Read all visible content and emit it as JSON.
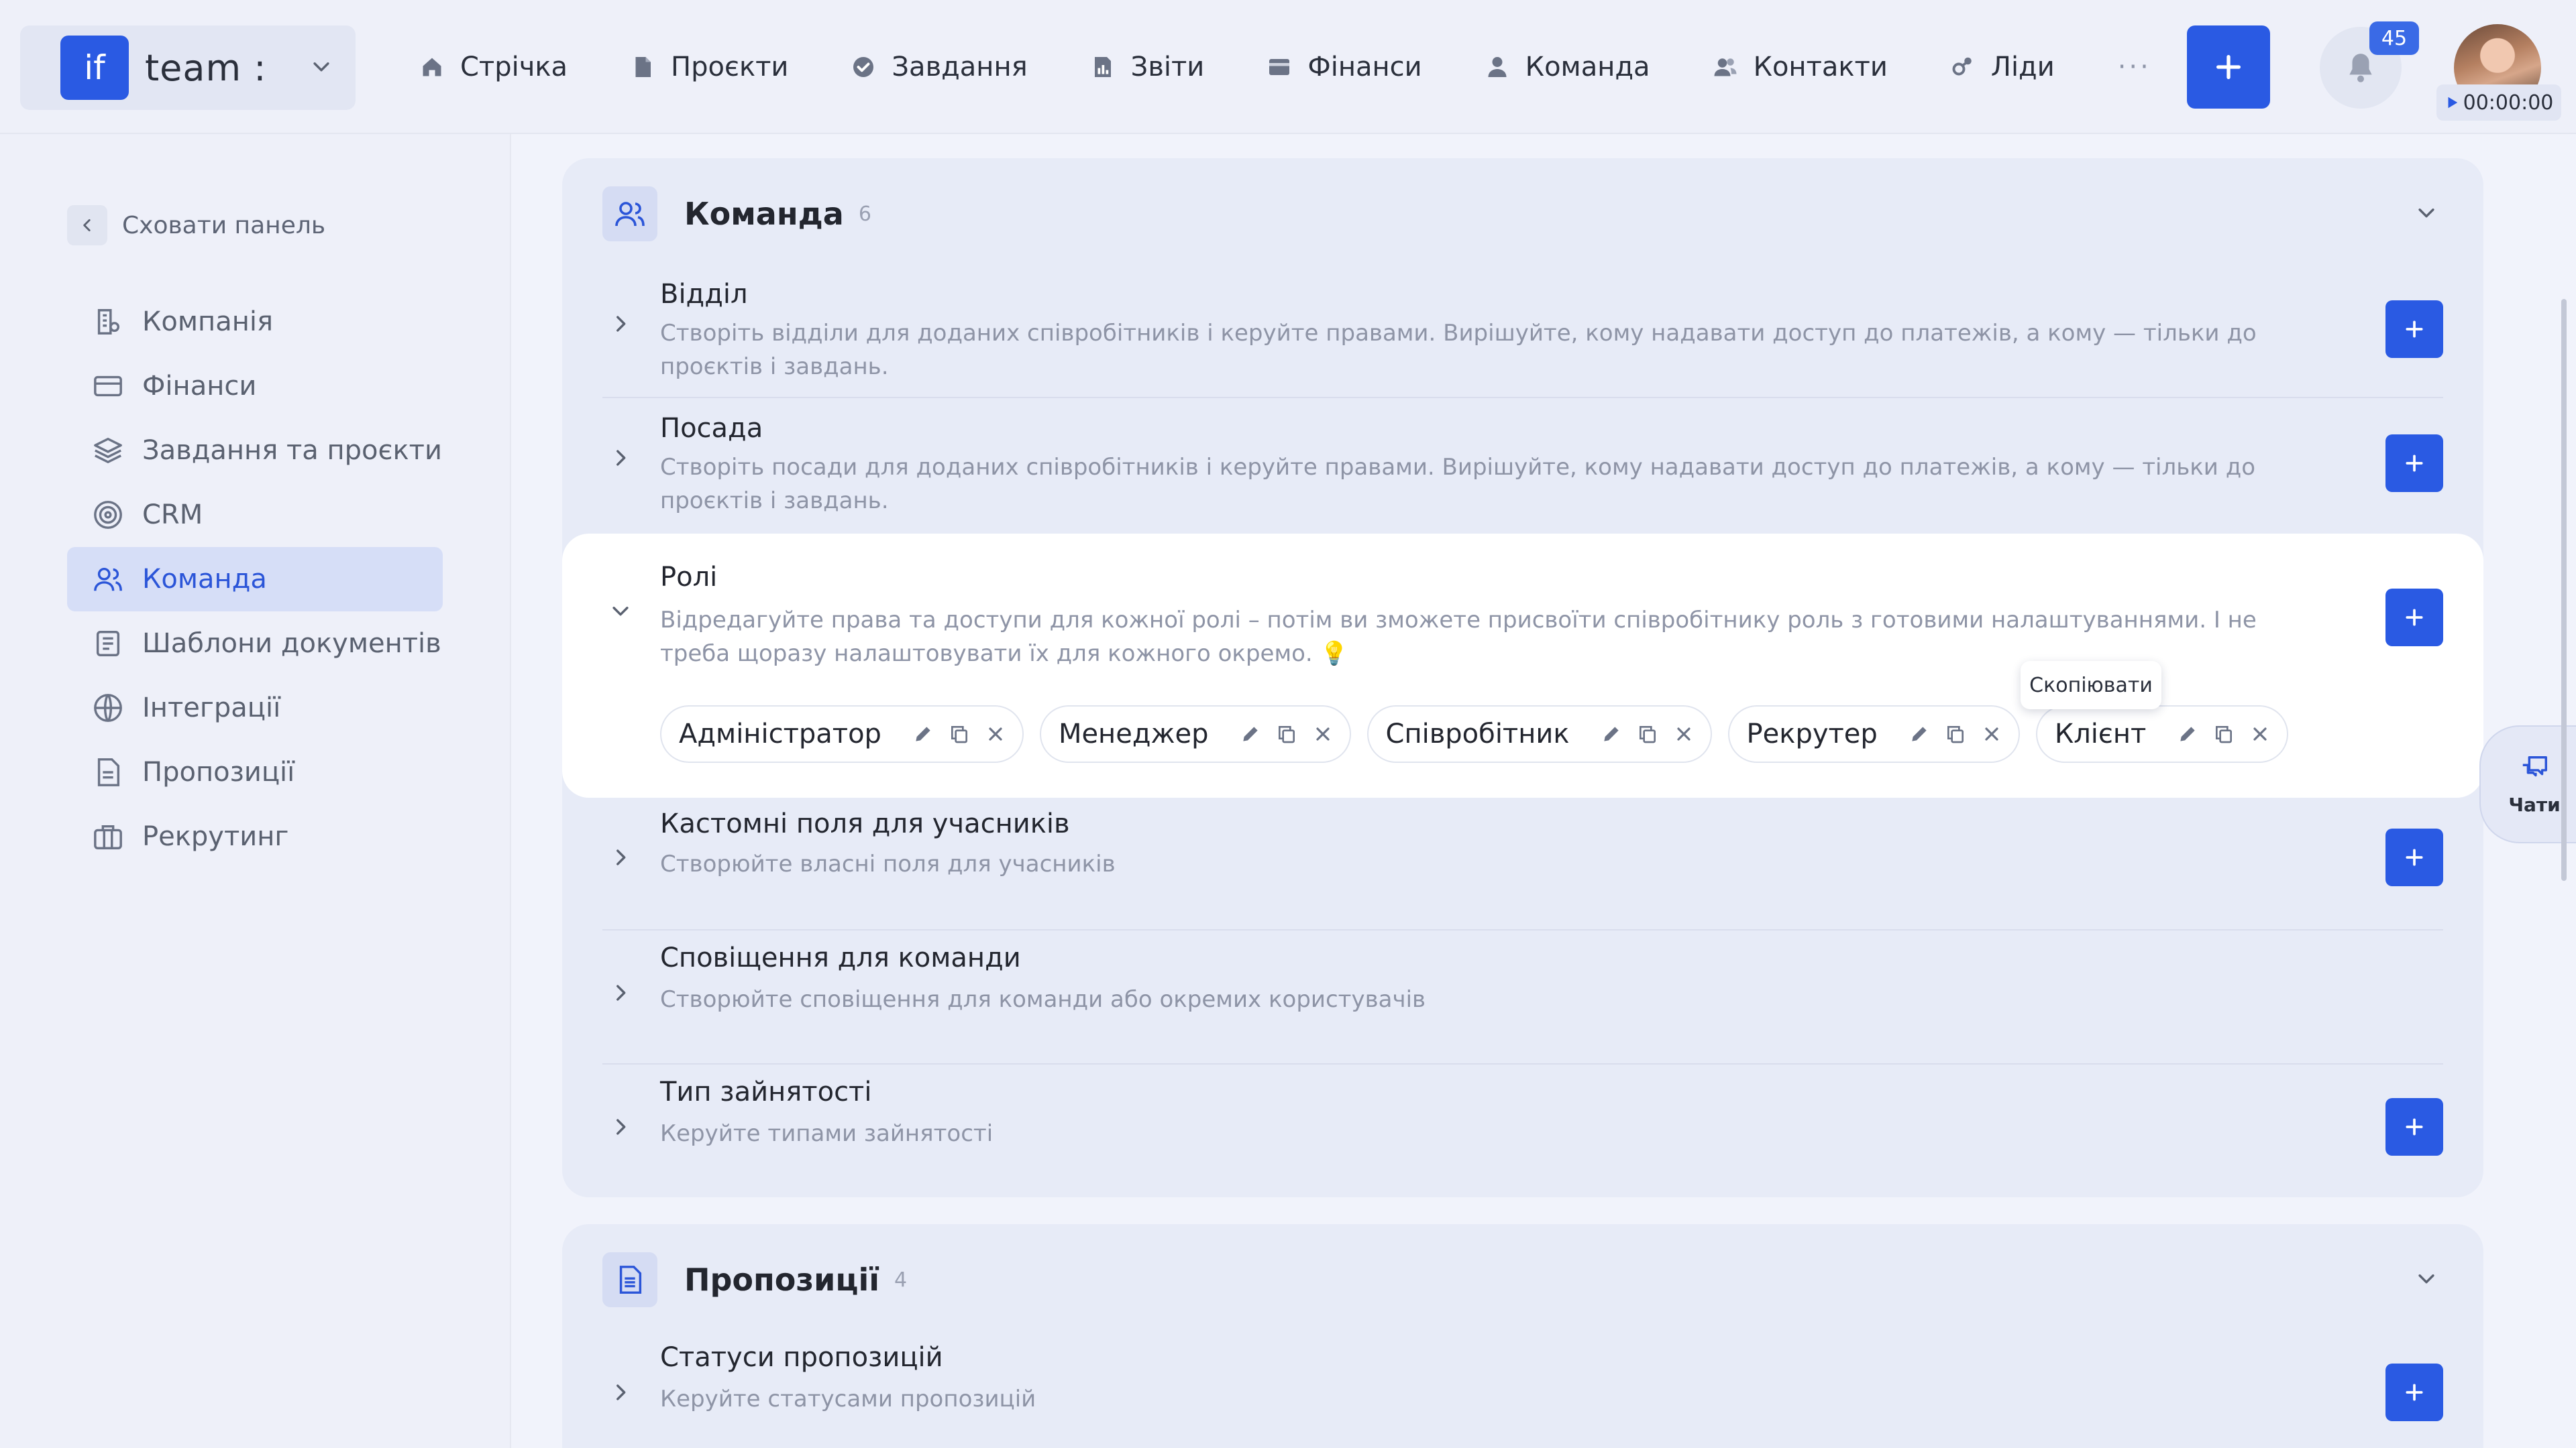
{
  "brand": {
    "logo": "if",
    "name": "team :"
  },
  "nav": {
    "items": [
      {
        "label": "Стрічка",
        "icon": "home-icon"
      },
      {
        "label": "Проєкти",
        "icon": "document-icon"
      },
      {
        "label": "Завдання",
        "icon": "check-circle-icon"
      },
      {
        "label": "Звіти",
        "icon": "report-icon"
      },
      {
        "label": "Фінанси",
        "icon": "wallet-icon"
      },
      {
        "label": "Команда",
        "icon": "person-icon"
      },
      {
        "label": "Контакти",
        "icon": "contacts-icon"
      },
      {
        "label": "Ліди",
        "icon": "leads-icon"
      }
    ],
    "more": "···"
  },
  "notifications": {
    "count": "45"
  },
  "timer": {
    "value": "00:00:00"
  },
  "sidebar": {
    "hide_label": "Сховати панель",
    "items": [
      {
        "label": "Компанія",
        "icon": "company-icon"
      },
      {
        "label": "Фінанси",
        "icon": "card-icon"
      },
      {
        "label": "Завдання та проєкти",
        "icon": "layers-icon"
      },
      {
        "label": "CRM",
        "icon": "target-icon"
      },
      {
        "label": "Команда",
        "icon": "team-icon",
        "active": true
      },
      {
        "label": "Шаблони документів",
        "icon": "template-icon"
      },
      {
        "label": "Інтеграції",
        "icon": "globe-icon"
      },
      {
        "label": "Пропозиції",
        "icon": "proposal-icon"
      },
      {
        "label": "Рекрутинг",
        "icon": "briefcase-icon"
      }
    ]
  },
  "team_section": {
    "title": "Команда",
    "count": "6",
    "rows": [
      {
        "title": "Відділ",
        "desc": "Створіть відділи для доданих співробітників і керуйте правами. Вирішуйте, кому надавати доступ до платежів, а кому — тільки до проєктів і завдань."
      },
      {
        "title": "Посада",
        "desc": "Створіть посади для доданих співробітників і керуйте правами. Вирішуйте, кому надавати доступ до платежів, а кому — тільки до проєктів і завдань."
      },
      {
        "title": "Ролі",
        "desc": "Відредагуйте права та доступи для кожної ролі – потім ви зможете присвоїти співробітнику роль з готовими налаштуваннями. І не треба щоразу налаштовувати їх для кожного окремо. 💡"
      },
      {
        "title": "Кастомні поля для учасників",
        "desc": "Створюйте власні поля для учасників"
      },
      {
        "title": "Сповіщення для команди",
        "desc": "Створюйте сповіщення для команди або окремих користувачів"
      },
      {
        "title": "Тип зайнятості",
        "desc": "Керуйте типами зайнятості"
      }
    ],
    "roles": [
      "Адміністратор",
      "Менеджер",
      "Співробітник",
      "Рекрутер",
      "Клієнт"
    ],
    "tooltip": "Скопіювати"
  },
  "proposals_section": {
    "title": "Пропозиції",
    "count": "4",
    "rows": [
      {
        "title": "Статуси пропозицій",
        "desc": "Керуйте статусами пропозицій"
      }
    ]
  },
  "chats": {
    "label": "Чати"
  },
  "colors": {
    "accent": "#2a5ae3",
    "active_bg": "#d6def7",
    "background": "#f1f3fb"
  }
}
